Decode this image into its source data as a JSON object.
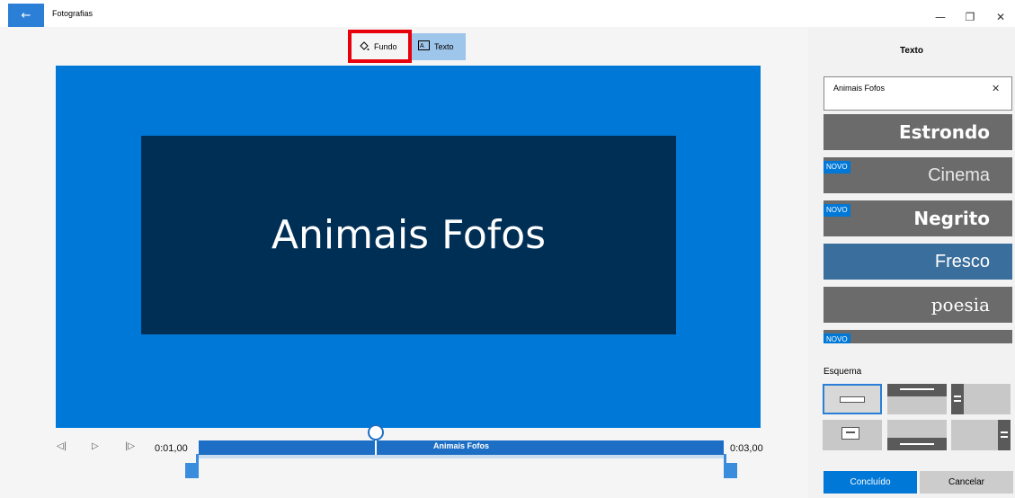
{
  "window": {
    "title": "Fotografias",
    "back_icon": "arrow-left-icon",
    "minimize_glyph": "—",
    "restore_glyph": "❐",
    "close_glyph": "✕"
  },
  "toolbar": {
    "background_label": "Fundo",
    "background_icon": "paint-bucket-icon",
    "text_label": "Texto",
    "text_icon": "text-box-icon"
  },
  "preview": {
    "title_text": "Animais Fofos",
    "canvas_color": "#0078d7",
    "card_color": "#002f56"
  },
  "playback": {
    "start_time": "0:01,00",
    "end_time": "0:03,00",
    "clip_label": "Animais Fofos",
    "prev_frame_glyph": "⏮",
    "play_glyph": "▷",
    "next_frame_glyph": "⏭"
  },
  "panel": {
    "title": "Texto",
    "input_value": "Animais Fofos",
    "clear_glyph": "✕",
    "styles": [
      {
        "label": "Estrondo",
        "new": false,
        "selected": false
      },
      {
        "label": "Cinema",
        "new": true,
        "selected": false
      },
      {
        "label": "Negrito",
        "new": true,
        "selected": false
      },
      {
        "label": "Fresco",
        "new": false,
        "selected": true
      },
      {
        "label": "poesia",
        "new": false,
        "selected": false
      },
      {
        "label": "",
        "new": true,
        "selected": false
      }
    ],
    "new_badge": "NOVO",
    "layout_label": "Esquema",
    "done_label": "Concluído",
    "cancel_label": "Cancelar"
  }
}
